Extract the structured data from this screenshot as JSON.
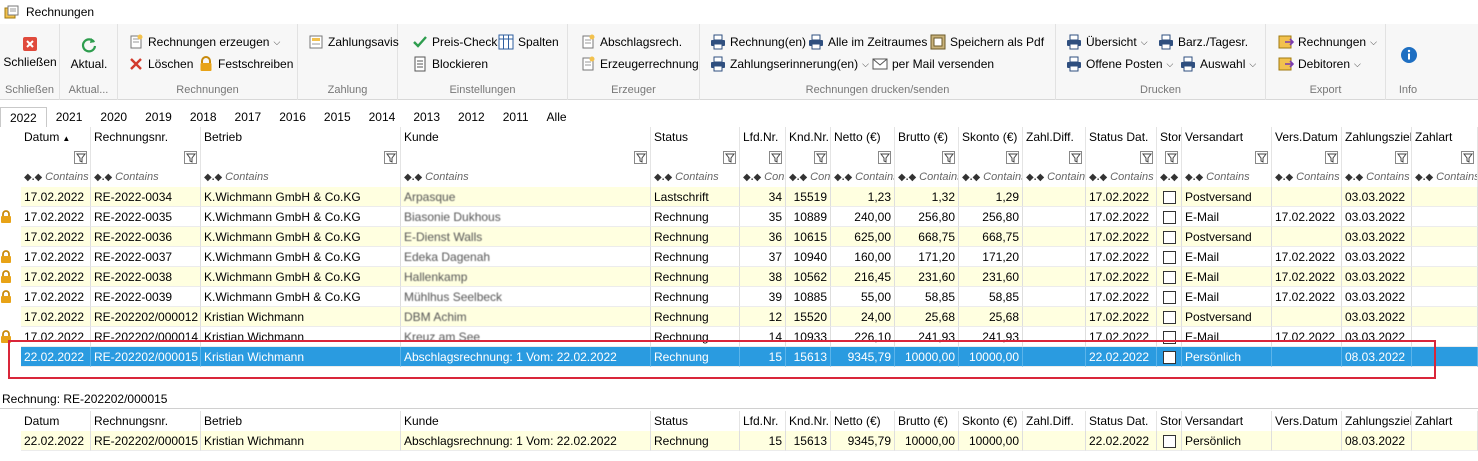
{
  "window": {
    "title": "Rechnungen"
  },
  "ribbon": {
    "groups": {
      "schliessen": "Schließen",
      "aktual": "Aktual...",
      "rechnungen": "Rechnungen",
      "zahlung": "Zahlung",
      "einstellungen": "Einstellungen",
      "erzeuger": "Erzeuger",
      "drucken_senden": "Rechnungen drucken/senden",
      "drucken": "Drucken",
      "export": "Export",
      "info": "Info"
    },
    "buttons": {
      "schliessen": "Schließen",
      "aktual": "Aktual.",
      "rechnungen_erzeugen": "Rechnungen erzeugen",
      "loeschen": "Löschen",
      "festschreiben": "Festschreiben",
      "zahlungsavis": "Zahlungsavis",
      "preis_check": "Preis-Check",
      "spalten": "Spalten",
      "blockieren": "Blockieren",
      "abschlagsrech": "Abschlagsrech.",
      "erzeugerrechnung": "Erzeugerrechnung",
      "rechnungen_n": "Rechnung(en)",
      "alle_im_zeitraum": "Alle im Zeitraumes",
      "speichern_pdf": "Speichern als Pdf",
      "zahlungserinnerung": "Zahlungserinnerung(en)",
      "per_mail": "per Mail versenden",
      "uebersicht": "Übersicht",
      "barz": "Barz./Tagesr.",
      "offene_posten": "Offene Posten",
      "auswahl": "Auswahl",
      "export_rechnungen": "Rechnungen",
      "export_debitoren": "Debitoren"
    }
  },
  "years": [
    "2022",
    "2021",
    "2020",
    "2019",
    "2018",
    "2017",
    "2016",
    "2015",
    "2014",
    "2013",
    "2012",
    "2011",
    "Alle"
  ],
  "columns": [
    "Datum",
    "Rechnungsnr.",
    "Betrieb",
    "Kunde",
    "Status",
    "Lfd.Nr.",
    "Knd.Nr.",
    "Netto (€)",
    "Brutto (€)",
    "Skonto (€)",
    "Zahl.Diff.",
    "Status Dat.",
    "Stor",
    "Versandart",
    "Vers.Datum",
    "Zahlungsziel",
    "Zahlart"
  ],
  "sort_indicator": "▲",
  "filter": {
    "op": "◆.◆",
    "contains": "Contains",
    "contains_short": "Conta",
    "contains_short2": "Contains",
    "contains_short3": "Contain:"
  },
  "rows": [
    {
      "datum": "17.02.2022",
      "nr": "RE-2022-0034",
      "betrieb": "K.Wichmann GmbH & Co.KG",
      "kunde": "Arpasque",
      "status": "Lastschrift",
      "lfd": "34",
      "knd": "15519",
      "netto": "1,23",
      "brutto": "1,32",
      "skonto": "1,29",
      "zdiff": "",
      "sdat": "17.02.2022",
      "versand": "Postversand",
      "vdat": "",
      "ziel": "03.03.2022",
      "locked": false
    },
    {
      "datum": "17.02.2022",
      "nr": "RE-2022-0035",
      "betrieb": "K.Wichmann GmbH & Co.KG",
      "kunde": "Biasonie Dukhous",
      "status": "Rechnung",
      "lfd": "35",
      "knd": "10889",
      "netto": "240,00",
      "brutto": "256,80",
      "skonto": "256,80",
      "zdiff": "",
      "sdat": "17.02.2022",
      "versand": "E-Mail",
      "vdat": "17.02.2022",
      "ziel": "03.03.2022",
      "locked": true
    },
    {
      "datum": "17.02.2022",
      "nr": "RE-2022-0036",
      "betrieb": "K.Wichmann GmbH & Co.KG",
      "kunde": "E-Dienst Walls",
      "status": "Rechnung",
      "lfd": "36",
      "knd": "10615",
      "netto": "625,00",
      "brutto": "668,75",
      "skonto": "668,75",
      "zdiff": "",
      "sdat": "17.02.2022",
      "versand": "Postversand",
      "vdat": "",
      "ziel": "03.03.2022",
      "locked": false
    },
    {
      "datum": "17.02.2022",
      "nr": "RE-2022-0037",
      "betrieb": "K.Wichmann GmbH & Co.KG",
      "kunde": "Edeka Dagenah",
      "status": "Rechnung",
      "lfd": "37",
      "knd": "10940",
      "netto": "160,00",
      "brutto": "171,20",
      "skonto": "171,20",
      "zdiff": "",
      "sdat": "17.02.2022",
      "versand": "E-Mail",
      "vdat": "17.02.2022",
      "ziel": "03.03.2022",
      "locked": true
    },
    {
      "datum": "17.02.2022",
      "nr": "RE-2022-0038",
      "betrieb": "K.Wichmann GmbH & Co.KG",
      "kunde": "Hallenkamp",
      "status": "Rechnung",
      "lfd": "38",
      "knd": "10562",
      "netto": "216,45",
      "brutto": "231,60",
      "skonto": "231,60",
      "zdiff": "",
      "sdat": "17.02.2022",
      "versand": "E-Mail",
      "vdat": "17.02.2022",
      "ziel": "03.03.2022",
      "locked": true
    },
    {
      "datum": "17.02.2022",
      "nr": "RE-2022-0039",
      "betrieb": "K.Wichmann GmbH & Co.KG",
      "kunde": "Mühlhus Seelbeck",
      "status": "Rechnung",
      "lfd": "39",
      "knd": "10885",
      "netto": "55,00",
      "brutto": "58,85",
      "skonto": "58,85",
      "zdiff": "",
      "sdat": "17.02.2022",
      "versand": "E-Mail",
      "vdat": "17.02.2022",
      "ziel": "03.03.2022",
      "locked": true
    },
    {
      "datum": "17.02.2022",
      "nr": "RE-202202/000012",
      "betrieb": "Kristian Wichmann",
      "kunde": "DBM Achim",
      "status": "Rechnung",
      "lfd": "12",
      "knd": "15520",
      "netto": "24,00",
      "brutto": "25,68",
      "skonto": "25,68",
      "zdiff": "",
      "sdat": "17.02.2022",
      "versand": "Postversand",
      "vdat": "",
      "ziel": "03.03.2022",
      "locked": false
    },
    {
      "datum": "17.02.2022",
      "nr": "RE-202202/000014",
      "betrieb": "Kristian Wichmann",
      "kunde": "Kreuz am See",
      "status": "Rechnung",
      "lfd": "14",
      "knd": "10933",
      "netto": "226,10",
      "brutto": "241,93",
      "skonto": "241,93",
      "zdiff": "",
      "sdat": "17.02.2022",
      "versand": "E-Mail",
      "vdat": "17.02.2022",
      "ziel": "03.03.2022",
      "locked": true
    },
    {
      "datum": "22.02.2022",
      "nr": "RE-202202/000015",
      "betrieb": "Kristian Wichmann",
      "kunde": "Abschlagsrechnung: 1 Vom: 22.02.2022",
      "status": "Rechnung",
      "lfd": "15",
      "knd": "15613",
      "netto": "9345,79",
      "brutto": "10000,00",
      "skonto": "10000,00",
      "zdiff": "",
      "sdat": "22.02.2022",
      "versand": "Persönlich",
      "vdat": "",
      "ziel": "08.03.2022",
      "locked": false
    }
  ],
  "detail": {
    "title": "Rechnung: RE-202202/000015",
    "row": {
      "datum": "22.02.2022",
      "nr": "RE-202202/000015",
      "betrieb": "Kristian Wichmann",
      "kunde": "Abschlagsrechnung: 1 Vom: 22.02.2022",
      "status": "Rechnung",
      "lfd": "15",
      "knd": "15613",
      "netto": "9345,79",
      "brutto": "10000,00",
      "skonto": "10000,00",
      "zdiff": "",
      "sdat": "22.02.2022",
      "versand": "Persönlich",
      "vdat": "",
      "ziel": "08.03.2022"
    }
  },
  "colors": {
    "selection": "#2a9be0",
    "highlight_border": "#d9263a",
    "row_yellow": "#ffffe0",
    "lock": "#e8a317",
    "print": "#2f4f7f",
    "info": "#1e6fc2"
  }
}
